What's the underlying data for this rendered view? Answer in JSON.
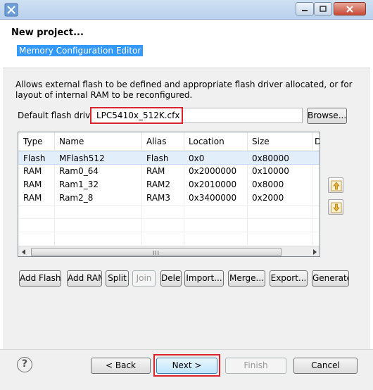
{
  "window": {
    "minimize_icon": "minimize-icon",
    "maximize_icon": "maximize-icon",
    "close_icon": "close-icon"
  },
  "banner": {
    "title": "New project...",
    "subtitle": "Memory Configuration Editor"
  },
  "description": "Allows external flash to be defined and appropriate flash driver allocated, or for layout of internal RAM to be reconfigured.",
  "flash": {
    "label": "Default flash driver",
    "value": "LPC5410x_512K.cfx",
    "browse_label": "Browse..."
  },
  "table": {
    "columns": [
      "Type",
      "Name",
      "Alias",
      "Location",
      "Size",
      "D"
    ],
    "rows": [
      {
        "type": "Flash",
        "name": "MFlash512",
        "alias": "Flash",
        "location": "0x0",
        "size": "0x80000"
      },
      {
        "type": "RAM",
        "name": "Ram0_64",
        "alias": "RAM",
        "location": "0x2000000",
        "size": "0x10000"
      },
      {
        "type": "RAM",
        "name": "Ram1_32",
        "alias": "RAM2",
        "location": "0x2010000",
        "size": "0x8000"
      },
      {
        "type": "RAM",
        "name": "Ram2_8",
        "alias": "RAM3",
        "location": "0x3400000",
        "size": "0x2000"
      }
    ],
    "scroll_grip": "III"
  },
  "actions": {
    "add_flash": "Add Flash",
    "add_ram": "Add RAM",
    "split": "Split",
    "join": "Join",
    "delete": "Delete",
    "import": "Import...",
    "merge": "Merge...",
    "export": "Export...",
    "generate": "Generate"
  },
  "footer": {
    "help": "?",
    "back": "< Back",
    "next": "Next >",
    "finish": "Finish",
    "cancel": "Cancel"
  },
  "colors": {
    "highlight_red": "#d9232d",
    "selection_blue": "#3399ff"
  }
}
